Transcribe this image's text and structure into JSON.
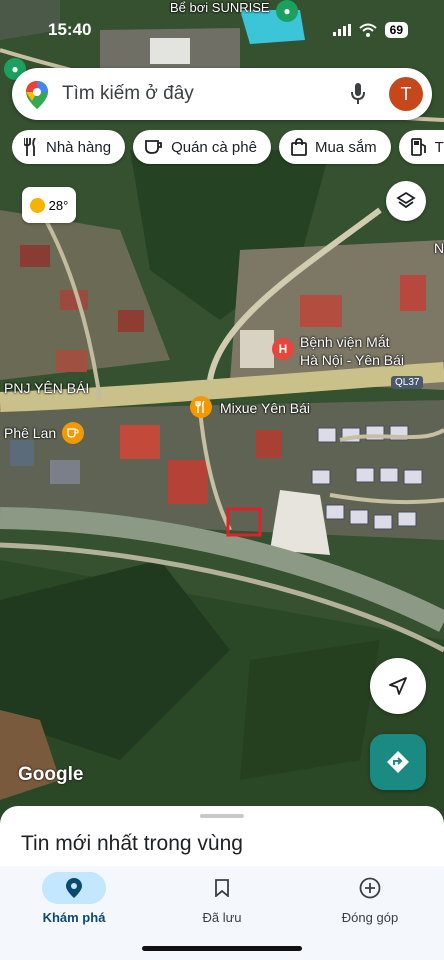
{
  "status_bar": {
    "time": "15:40",
    "battery": "69"
  },
  "search": {
    "placeholder": "Tìm kiếm ở đây",
    "avatar_letter": "T"
  },
  "chips": [
    {
      "label": "Nhà hàng",
      "icon": "restaurant-icon"
    },
    {
      "label": "Quán cà phê",
      "icon": "cafe-icon"
    },
    {
      "label": "Mua sắm",
      "icon": "shopping-icon"
    },
    {
      "label": "Trạm",
      "icon": "gas-station-icon"
    }
  ],
  "weather": {
    "temp": "28°"
  },
  "map_labels": {
    "top_place": "Bể bơi SUNRISE",
    "hospital_line1": "Bệnh viện Mắt",
    "hospital_line2": "Hà Nội - Yên Bái",
    "road_code": "QL37",
    "store1": "PNJ YÊN BÁI",
    "cafe": "Phê Lan",
    "restaurant": "Mixue Yên Bái",
    "edge_letter": "N"
  },
  "attribution": "Google",
  "sheet": {
    "title": "Tin mới nhất trong vùng"
  },
  "nav": [
    {
      "label": "Khám phá",
      "icon": "explore-pin-icon",
      "active": true
    },
    {
      "label": "Đã lưu",
      "icon": "bookmark-icon",
      "active": false
    },
    {
      "label": "Đóng góp",
      "icon": "add-circle-icon",
      "active": false
    }
  ],
  "colors": {
    "accent": "#1a8a82",
    "avatar": "#c5471b",
    "hospital_pin": "#e8453c",
    "poi_pin": "#f29900",
    "highlight_box": "#e0202a"
  }
}
